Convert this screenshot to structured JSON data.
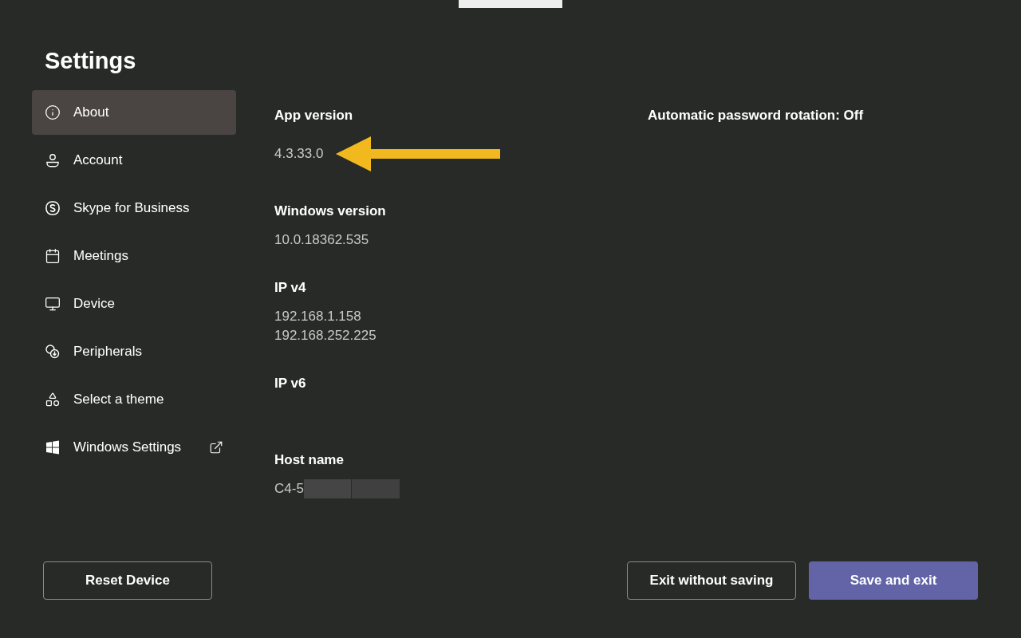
{
  "title": "Settings",
  "sidebar": {
    "items": [
      {
        "label": "About",
        "selected": true,
        "external": false
      },
      {
        "label": "Account",
        "selected": false,
        "external": false
      },
      {
        "label": "Skype for Business",
        "selected": false,
        "external": false
      },
      {
        "label": "Meetings",
        "selected": false,
        "external": false
      },
      {
        "label": "Device",
        "selected": false,
        "external": false
      },
      {
        "label": "Peripherals",
        "selected": false,
        "external": false
      },
      {
        "label": "Select a theme",
        "selected": false,
        "external": false
      },
      {
        "label": "Windows Settings",
        "selected": false,
        "external": true
      }
    ]
  },
  "details": [
    {
      "label": "App version",
      "values": [
        "4.3.33.0"
      ],
      "redacted": false
    },
    {
      "label": "Windows version",
      "values": [
        "10.0.18362.535"
      ],
      "redacted": false
    },
    {
      "label": "IP v4",
      "values": [
        "192.168.1.158",
        "192.168.252.225"
      ],
      "redacted": false
    },
    {
      "label": "IP v6"
    },
    {
      "label": "Host name",
      "values": [
        "C4-5"
      ],
      "redacted": true
    }
  ],
  "password_rotation": "Automatic password rotation: Off",
  "buttons": {
    "reset": "Reset Device",
    "exit": "Exit without saving",
    "save": "Save and exit"
  }
}
